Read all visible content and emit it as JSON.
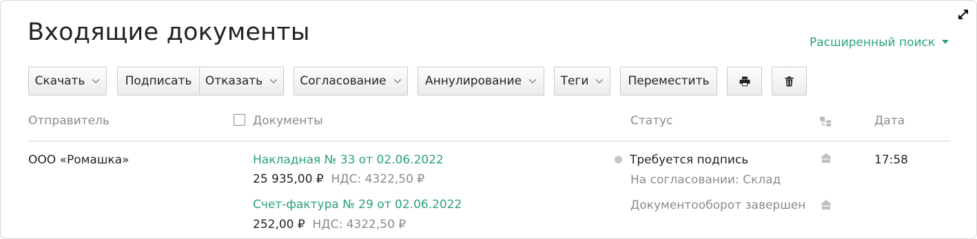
{
  "page": {
    "title": "Входящие документы",
    "advanced_search": "Расширенный поиск"
  },
  "toolbar": {
    "download": "Скачать",
    "sign": "Подписать",
    "reject": "Отказать",
    "approval": "Согласование",
    "annulment": "Аннулирование",
    "tags": "Теги",
    "move": "Переместить",
    "print_icon": "printer-icon",
    "delete_icon": "trash-icon"
  },
  "table": {
    "columns": {
      "sender": "Отправитель",
      "documents": "Документы",
      "status": "Статус",
      "date": "Дата"
    },
    "rows": [
      {
        "sender": "ООО «Ромашка»",
        "documents": [
          {
            "title": "Накладная № 33 от 02.06.2022",
            "amount": "25 935,00 ₽",
            "vat": "НДС: 4322,50 ₽"
          },
          {
            "title": "Счет-фактура № 29 от 02.06.2022",
            "amount": "252,00 ₽",
            "vat": "НДС: 4322,50 ₽"
          }
        ],
        "status_main": "Требуется подпись",
        "status_sub": "На согласовании: Склад",
        "status_second": "Документооборот завершен",
        "time": "17:58"
      }
    ]
  },
  "colors": {
    "accent": "#2aa17e",
    "muted": "#8a8a8a",
    "border": "#c9c9c9"
  }
}
